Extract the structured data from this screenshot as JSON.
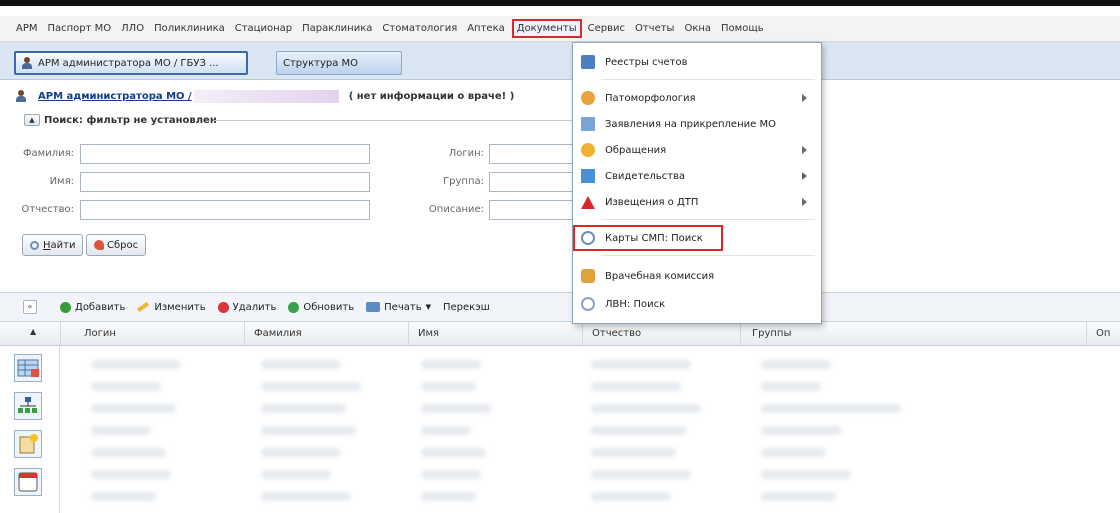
{
  "menubar": {
    "items": [
      "АРМ",
      "Паспорт МО",
      "ЛЛО",
      "Поликлиника",
      "Стационар",
      "Параклиника",
      "Стоматология",
      "Аптека",
      "Документы",
      "Сервис",
      "Отчеты",
      "Окна",
      "Помощь"
    ],
    "active_index": 8
  },
  "tabs": {
    "tab1": "АРМ администратора МО / ГБУЗ ...",
    "tab2": "Структура МО"
  },
  "header": {
    "link": "АРМ администратора МО / ",
    "note": "( нет информации о враче! )"
  },
  "search": {
    "title": "Поиск: фильтр не установлен",
    "fields": {
      "surname": "Фамилия:",
      "name": "Имя:",
      "patronymic": "Отчество:",
      "login": "Логин:",
      "group": "Группа:",
      "description": "Описание:"
    },
    "find_prefix": "",
    "find_underlined": "Н",
    "find_rest": "айти",
    "reset": "Сброс"
  },
  "toolbar": {
    "collapse": "«",
    "add": "Добавить",
    "edit": "Изменить",
    "delete": "Удалить",
    "refresh": "Обновить",
    "print": "Печать",
    "extra": "Перекэш"
  },
  "grid": {
    "sort": "▲",
    "columns": [
      "Логин",
      "Фамилия",
      "Имя",
      "Отчество",
      "Группы",
      "Оп"
    ]
  },
  "dropdown": {
    "items": [
      {
        "label": "Реестры счетов",
        "submenu": false,
        "icon": "register-icon"
      },
      {
        "label": "Патоморфология",
        "submenu": true,
        "icon": "pathology-icon"
      },
      {
        "label": "Заявления на прикрепление МО",
        "submenu": false,
        "icon": "application-icon"
      },
      {
        "label": "Обращения",
        "submenu": true,
        "icon": "appeal-icon"
      },
      {
        "label": "Свидетельства",
        "submenu": true,
        "icon": "certificate-icon"
      },
      {
        "label": "Извещения о ДТП",
        "submenu": true,
        "icon": "warning-icon"
      },
      {
        "label": "Карты СМП: Поиск",
        "submenu": false,
        "icon": "smp-search-icon"
      },
      {
        "label": "Врачебная комиссия",
        "submenu": false,
        "icon": "commission-icon"
      },
      {
        "label": "ЛВН: Поиск",
        "submenu": false,
        "icon": "lvn-search-icon"
      }
    ],
    "highlight_index": 6
  },
  "colors": {
    "highlight": "#d8282f",
    "tab_bar": "#dbe6f3"
  }
}
